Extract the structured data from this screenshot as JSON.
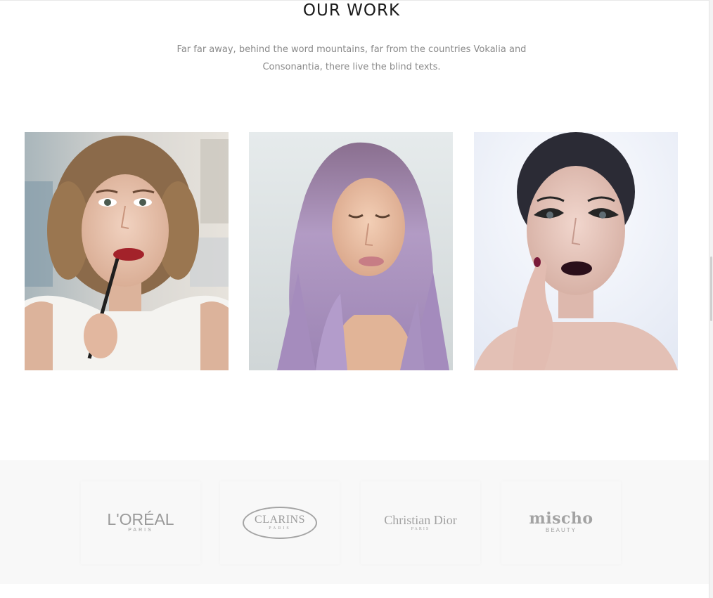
{
  "section": {
    "title": "OUR WORK",
    "subtitle_line1": "Far far away, behind the word mountains, far from the countries Vokalia and",
    "subtitle_line2": "Consonantia, there live the blind texts."
  },
  "gallery": {
    "items": [
      {
        "subject": "woman-applying-lipstick"
      },
      {
        "subject": "woman-with-lavender-hair"
      },
      {
        "subject": "woman-dramatic-makeup"
      }
    ]
  },
  "brands": {
    "items": [
      {
        "name": "L'ORÉAL",
        "sub": "PARIS"
      },
      {
        "name": "CLARINS",
        "sub": "PARIS"
      },
      {
        "name": "Christian Dior",
        "sub": "PARIS"
      },
      {
        "name": "mischo",
        "sub": "BEAUTY"
      }
    ]
  },
  "colors": {
    "text_dark": "#1a1a1a",
    "text_muted": "#8a8a8a",
    "brand_gray": "#9a9a9a",
    "brands_bg": "#f8f8f8"
  }
}
